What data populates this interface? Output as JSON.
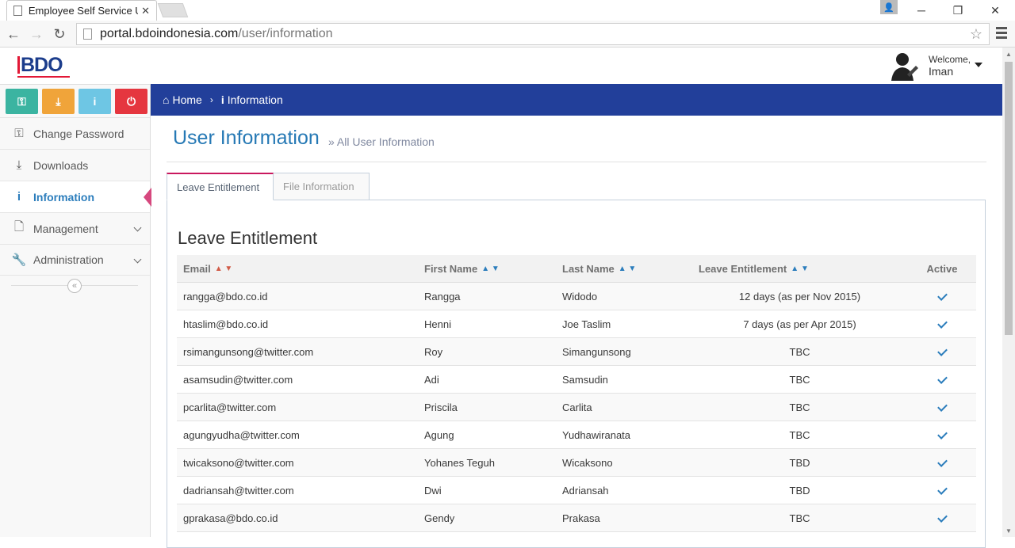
{
  "browser": {
    "tab_title": "Employee Self Service User Information",
    "url_host": "portal.bdoindonesia.com",
    "url_path": "/user/information"
  },
  "header": {
    "logo": "BDO",
    "welcome": "Welcome,",
    "username": "Iman"
  },
  "sidebar": {
    "items": [
      {
        "label": "Change Password",
        "icon": "key-icon"
      },
      {
        "label": "Downloads",
        "icon": "download-icon"
      },
      {
        "label": "Information",
        "icon": "info-icon"
      },
      {
        "label": "Management",
        "icon": "file-icon"
      },
      {
        "label": "Administration",
        "icon": "wrench-icon"
      }
    ],
    "shortcut_colors": [
      "#3bb4a1",
      "#f0a43a",
      "#6ec6e4",
      "#e5363f"
    ]
  },
  "breadcrumbs": {
    "home": "Home",
    "current": "Information"
  },
  "page": {
    "title": "User Information",
    "subtitle": "» All User Information"
  },
  "tabs": {
    "leave": "Leave Entitlement",
    "file": "File Information"
  },
  "section_title": "Leave Entitlement",
  "table": {
    "headers": {
      "email": "Email",
      "first_name": "First Name",
      "last_name": "Last Name",
      "leave": "Leave Entitlement",
      "active": "Active"
    },
    "rows": [
      {
        "email": "rangga@bdo.co.id",
        "first": "Rangga",
        "last": "Widodo",
        "leave": "12 days (as per Nov 2015)"
      },
      {
        "email": "htaslim@bdo.co.id",
        "first": "Henni",
        "last": "Joe Taslim",
        "leave": "7 days (as per Apr 2015)"
      },
      {
        "email": "rsimangunsong@twitter.com",
        "first": "Roy",
        "last": "Simangunsong",
        "leave": "TBC"
      },
      {
        "email": "asamsudin@twitter.com",
        "first": "Adi",
        "last": "Samsudin",
        "leave": "TBC"
      },
      {
        "email": "pcarlita@twitter.com",
        "first": "Priscila",
        "last": "Carlita",
        "leave": "TBC"
      },
      {
        "email": "agungyudha@twitter.com",
        "first": "Agung",
        "last": "Yudhawiranata",
        "leave": "TBC"
      },
      {
        "email": "twicaksono@twitter.com",
        "first": "Yohanes Teguh",
        "last": "Wicaksono",
        "leave": "TBD"
      },
      {
        "email": "dadriansah@twitter.com",
        "first": "Dwi",
        "last": "Adriansah",
        "leave": "TBD"
      },
      {
        "email": "gprakasa@bdo.co.id",
        "first": "Gendy",
        "last": "Prakasa",
        "leave": "TBC"
      }
    ]
  }
}
